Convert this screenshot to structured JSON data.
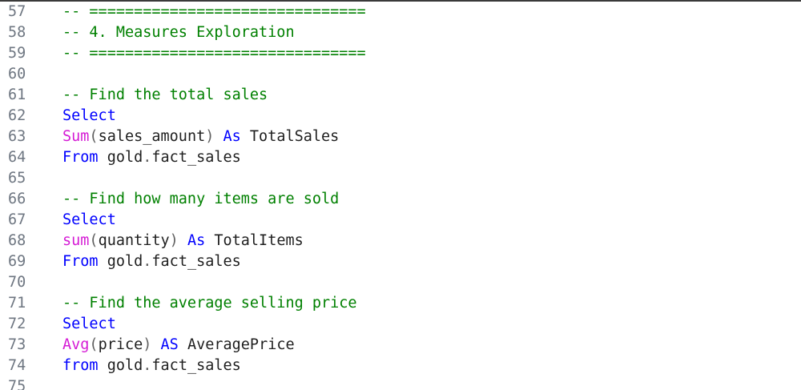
{
  "editor": {
    "colors": {
      "comment": "#008000",
      "keyword": "#0000ff",
      "function": "#d51bd5",
      "text": "#1f1f1f",
      "line_number": "#6e7681",
      "background": "#ffffff"
    },
    "lines": [
      {
        "number": "57",
        "tokens": [
          {
            "t": "comment",
            "v": "-- ==============================="
          }
        ]
      },
      {
        "number": "58",
        "tokens": [
          {
            "t": "comment",
            "v": "-- 4. Measures Exploration"
          }
        ]
      },
      {
        "number": "59",
        "tokens": [
          {
            "t": "comment",
            "v": "-- ==============================="
          }
        ]
      },
      {
        "number": "60",
        "tokens": []
      },
      {
        "number": "61",
        "tokens": [
          {
            "t": "comment",
            "v": "-- Find the total sales"
          }
        ]
      },
      {
        "number": "62",
        "tokens": [
          {
            "t": "keyword",
            "v": "Select"
          }
        ]
      },
      {
        "number": "63",
        "tokens": [
          {
            "t": "function",
            "v": "Sum"
          },
          {
            "t": "punct",
            "v": "("
          },
          {
            "t": "text",
            "v": "sales_amount"
          },
          {
            "t": "punct",
            "v": ")"
          },
          {
            "t": "text",
            "v": " "
          },
          {
            "t": "keyword",
            "v": "As"
          },
          {
            "t": "text",
            "v": " TotalSales"
          }
        ]
      },
      {
        "number": "64",
        "tokens": [
          {
            "t": "keyword",
            "v": "From"
          },
          {
            "t": "text",
            "v": " gold"
          },
          {
            "t": "punct",
            "v": "."
          },
          {
            "t": "text",
            "v": "fact_sales"
          }
        ]
      },
      {
        "number": "65",
        "tokens": []
      },
      {
        "number": "66",
        "tokens": [
          {
            "t": "comment",
            "v": "-- Find how many items are sold"
          }
        ]
      },
      {
        "number": "67",
        "tokens": [
          {
            "t": "keyword",
            "v": "Select"
          }
        ]
      },
      {
        "number": "68",
        "tokens": [
          {
            "t": "function",
            "v": "sum"
          },
          {
            "t": "punct",
            "v": "("
          },
          {
            "t": "text",
            "v": "quantity"
          },
          {
            "t": "punct",
            "v": ")"
          },
          {
            "t": "text",
            "v": " "
          },
          {
            "t": "keyword",
            "v": "As"
          },
          {
            "t": "text",
            "v": " TotalItems"
          }
        ]
      },
      {
        "number": "69",
        "tokens": [
          {
            "t": "keyword",
            "v": "From"
          },
          {
            "t": "text",
            "v": " gold"
          },
          {
            "t": "punct",
            "v": "."
          },
          {
            "t": "text",
            "v": "fact_sales"
          }
        ]
      },
      {
        "number": "70",
        "tokens": []
      },
      {
        "number": "71",
        "tokens": [
          {
            "t": "comment",
            "v": "-- Find the average selling price"
          }
        ]
      },
      {
        "number": "72",
        "tokens": [
          {
            "t": "keyword",
            "v": "Select"
          }
        ]
      },
      {
        "number": "73",
        "tokens": [
          {
            "t": "function",
            "v": "Avg"
          },
          {
            "t": "punct",
            "v": "("
          },
          {
            "t": "text",
            "v": "price"
          },
          {
            "t": "punct",
            "v": ")"
          },
          {
            "t": "text",
            "v": " "
          },
          {
            "t": "keyword",
            "v": "AS"
          },
          {
            "t": "text",
            "v": " AveragePrice"
          }
        ]
      },
      {
        "number": "74",
        "tokens": [
          {
            "t": "keyword",
            "v": "from"
          },
          {
            "t": "text",
            "v": " gold"
          },
          {
            "t": "punct",
            "v": "."
          },
          {
            "t": "text",
            "v": "fact_sales"
          }
        ]
      },
      {
        "number": "75",
        "tokens": []
      }
    ]
  }
}
